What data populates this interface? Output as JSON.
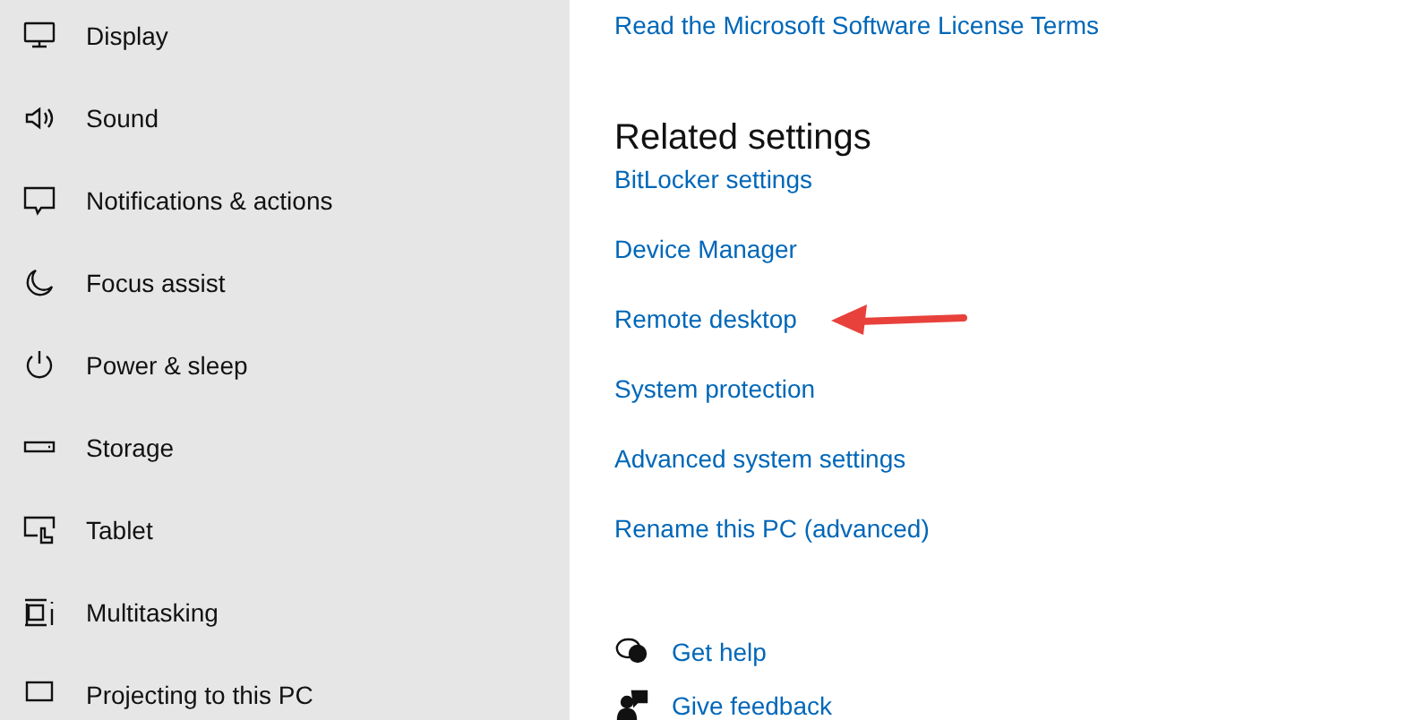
{
  "sidebar": {
    "items": [
      {
        "kind": "display",
        "label": "Display"
      },
      {
        "kind": "sound",
        "label": "Sound"
      },
      {
        "kind": "notifications",
        "label": "Notifications & actions"
      },
      {
        "kind": "focus",
        "label": "Focus assist"
      },
      {
        "kind": "power",
        "label": "Power & sleep"
      },
      {
        "kind": "storage",
        "label": "Storage"
      },
      {
        "kind": "tablet",
        "label": "Tablet"
      },
      {
        "kind": "multitasking",
        "label": "Multitasking"
      },
      {
        "kind": "projecting",
        "label": "Projecting to this PC"
      }
    ]
  },
  "main": {
    "license_link": "Read the Microsoft Software License Terms",
    "related_settings": {
      "title": "Related settings",
      "links": [
        {
          "label": "BitLocker settings",
          "annotated": false
        },
        {
          "label": "Device Manager",
          "annotated": false
        },
        {
          "label": "Remote desktop",
          "annotated": true
        },
        {
          "label": "System protection",
          "annotated": false
        },
        {
          "label": "Advanced system settings",
          "annotated": false
        },
        {
          "label": "Rename this PC (advanced)",
          "annotated": false
        }
      ]
    },
    "help_links": [
      {
        "kind": "help",
        "label": "Get help"
      },
      {
        "kind": "feedback",
        "label": "Give feedback"
      }
    ]
  }
}
